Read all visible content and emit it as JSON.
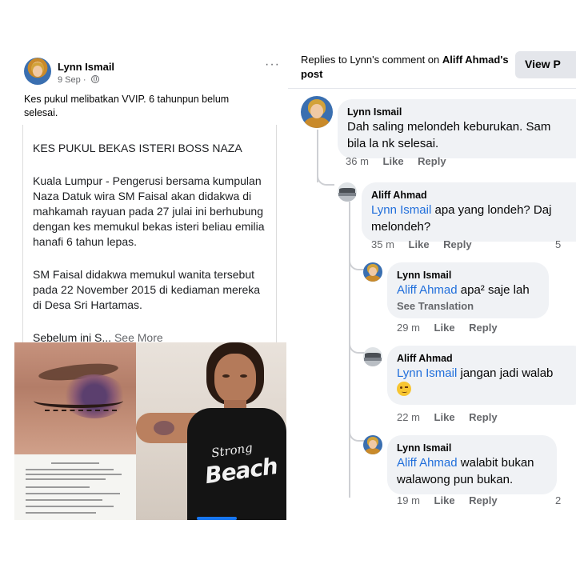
{
  "post": {
    "author": "Lynn Ismail",
    "date": "9 Sep",
    "meta_sep": "·",
    "more": "···",
    "caption": "Kes pukul melibatkan VVIP. 6 tahunpun belum selesai.",
    "card": {
      "heading": "KES PUKUL BEKAS ISTERI BOSS NAZA",
      "paragraph1": "Kuala Lumpur - Pengerusi bersama kumpulan Naza Datuk wira SM Faisal akan didakwa di mahkamah rayuan pada 27 julai ini berhubung dengan kes memukul bekas isteri beliau emilia hanafi 6 tahun lepas.",
      "paragraph2": "SM Faisal didakwa memukul wanita tersebut pada 22 November 2015 di kediaman mereka di Desa Sri Hartamas.",
      "last_line": "Sebelum ini S...",
      "see_more": "See More"
    },
    "shirt_text_1": "Strong",
    "shirt_text_2": "Beach"
  },
  "replies": {
    "header_prefix": "Replies to Lynn's comment on ",
    "header_name": "Aliff Ahmad",
    "header_suffix": "'s post",
    "view_button": "View P",
    "comments": [
      {
        "author": "Lynn Ismail",
        "line1": "Dah saling melondeh keburukan. Sam",
        "line2": "bila la nk selesai.",
        "time": "36 m",
        "like": "Like",
        "reply": "Reply"
      },
      {
        "author": "Aliff Ahmad",
        "mention": "Lynn Ismail",
        "line1": " apa yang londeh? Daj",
        "line2": "melondeh?",
        "time": "35 m",
        "like": "Like",
        "reply": "Reply",
        "edge": "5"
      },
      {
        "author": "Lynn Ismail",
        "mention": "Aliff Ahmad",
        "line1": " apa² saje lah",
        "see_translation": "See Translation",
        "time": "29 m",
        "like": "Like",
        "reply": "Reply"
      },
      {
        "author": "Aliff Ahmad",
        "mention": "Lynn Ismail",
        "line1": " jangan jadi walab",
        "emoji": "wink-emoji",
        "time": "22 m",
        "like": "Like",
        "reply": "Reply"
      },
      {
        "author": "Lynn Ismail",
        "mention": "Aliff Ahmad",
        "line1": " walabit bukan",
        "line2": "walawong pun bukan.",
        "time": "19 m",
        "like": "Like",
        "reply": "Reply",
        "edge": "2"
      }
    ]
  },
  "colors": {
    "mention": "#216fdb",
    "bubble": "#f0f2f5",
    "meta": "#65676b",
    "accent": "#1877f2"
  }
}
